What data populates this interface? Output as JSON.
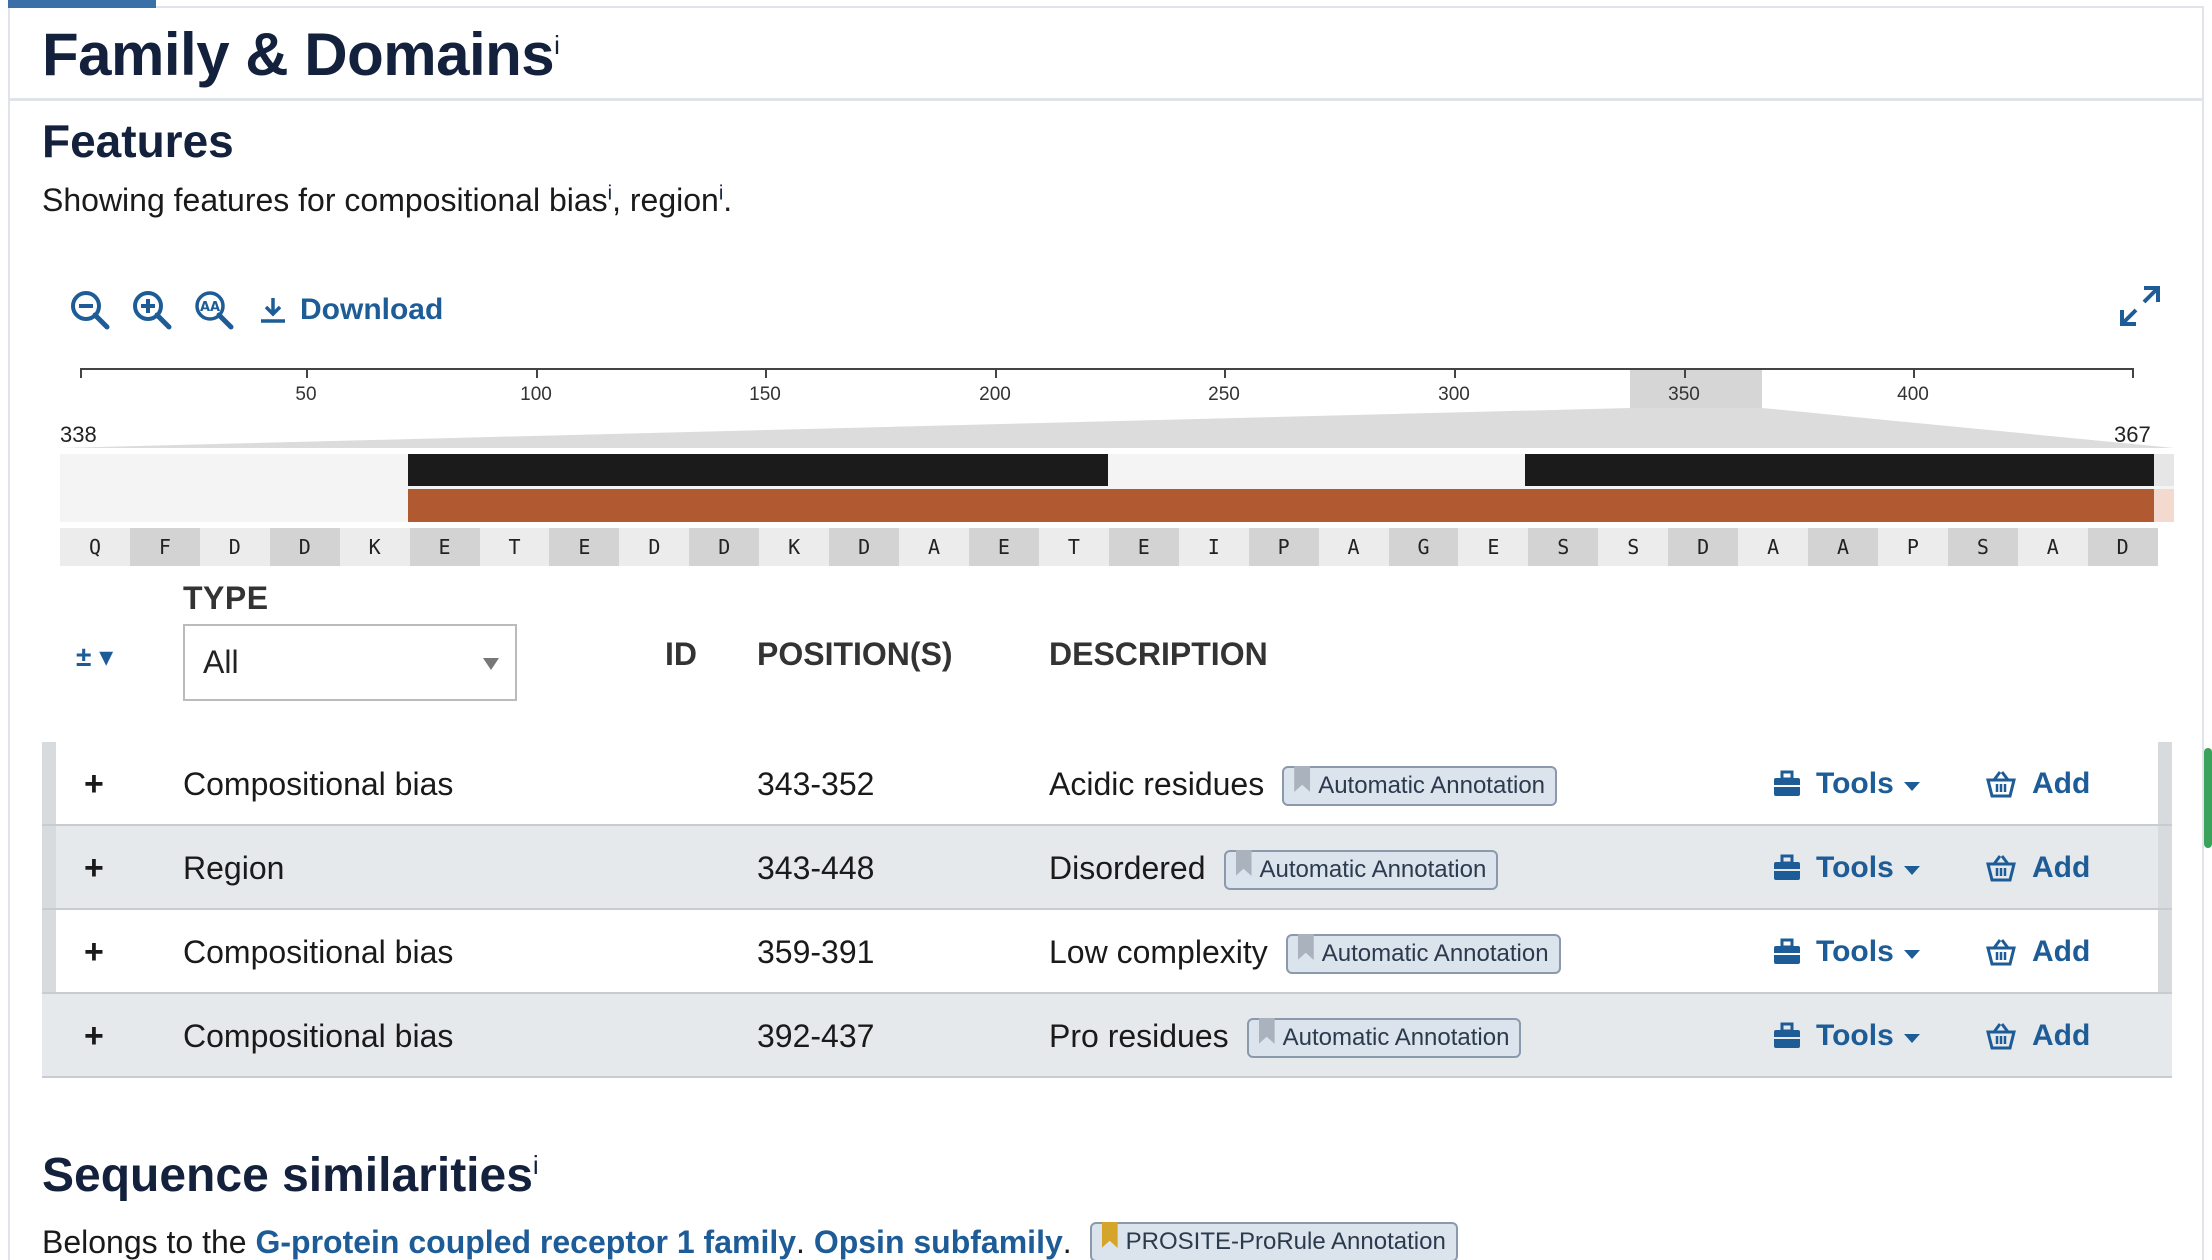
{
  "section": {
    "title": "Family & Domains",
    "info_marker": "i"
  },
  "features": {
    "heading": "Features",
    "showing_prefix": "Showing features for ",
    "showing_item_1": "compositional bias",
    "showing_sep": ", ",
    "showing_item_2": "region",
    "showing_suffix": "."
  },
  "toolbar": {
    "zoom_out_icon": "zoom-out-icon",
    "zoom_in_icon": "zoom-in-icon",
    "zoom_sequence_icon": "zoom-aa-icon",
    "download_label": "Download",
    "fullscreen_icon": "expand-icon"
  },
  "ruler": {
    "ticks": [
      "50",
      "100",
      "150",
      "200",
      "250",
      "300",
      "350",
      "400"
    ],
    "zoom_start": "338",
    "zoom_end": "367"
  },
  "sequence": [
    "Q",
    "F",
    "D",
    "D",
    "K",
    "E",
    "T",
    "E",
    "D",
    "D",
    "K",
    "D",
    "A",
    "E",
    "T",
    "E",
    "I",
    "P",
    "A",
    "G",
    "E",
    "S",
    "S",
    "D",
    "A",
    "A",
    "P",
    "S",
    "A",
    "D"
  ],
  "filter": {
    "toggle_label": "± ▾",
    "type_label": "TYPE",
    "type_value": "All"
  },
  "columns": {
    "id": "ID",
    "positions": "POSITION(S)",
    "description": "DESCRIPTION"
  },
  "rows": [
    {
      "expand": "+",
      "type": "Compositional bias",
      "position": "343-352",
      "description": "Acidic residues",
      "evidence": "Automatic Annotation",
      "tools": "Tools",
      "add": "Add"
    },
    {
      "expand": "+",
      "type": "Region",
      "position": "343-448",
      "description": "Disordered",
      "evidence": "Automatic Annotation",
      "tools": "Tools",
      "add": "Add"
    },
    {
      "expand": "+",
      "type": "Compositional bias",
      "position": "359-391",
      "description": "Low complexity",
      "evidence": "Automatic Annotation",
      "tools": "Tools",
      "add": "Add"
    },
    {
      "expand": "+",
      "type": "Compositional bias",
      "position": "392-437",
      "description": "Pro residues",
      "evidence": "Automatic Annotation",
      "tools": "Tools",
      "add": "Add"
    }
  ],
  "similarities": {
    "heading": "Sequence similarities",
    "prefix": "Belongs to the ",
    "link_family": "G-protein coupled receptor 1 family",
    "sep": ". ",
    "link_subfamily": "Opsin subfamily",
    "suffix": ".",
    "evidence": "PROSITE-ProRule Annotation"
  },
  "colors": {
    "link": "#1d5c96",
    "track_bias": "#1b1b1b",
    "track_region": "#b15a31",
    "heading": "#14213d"
  }
}
